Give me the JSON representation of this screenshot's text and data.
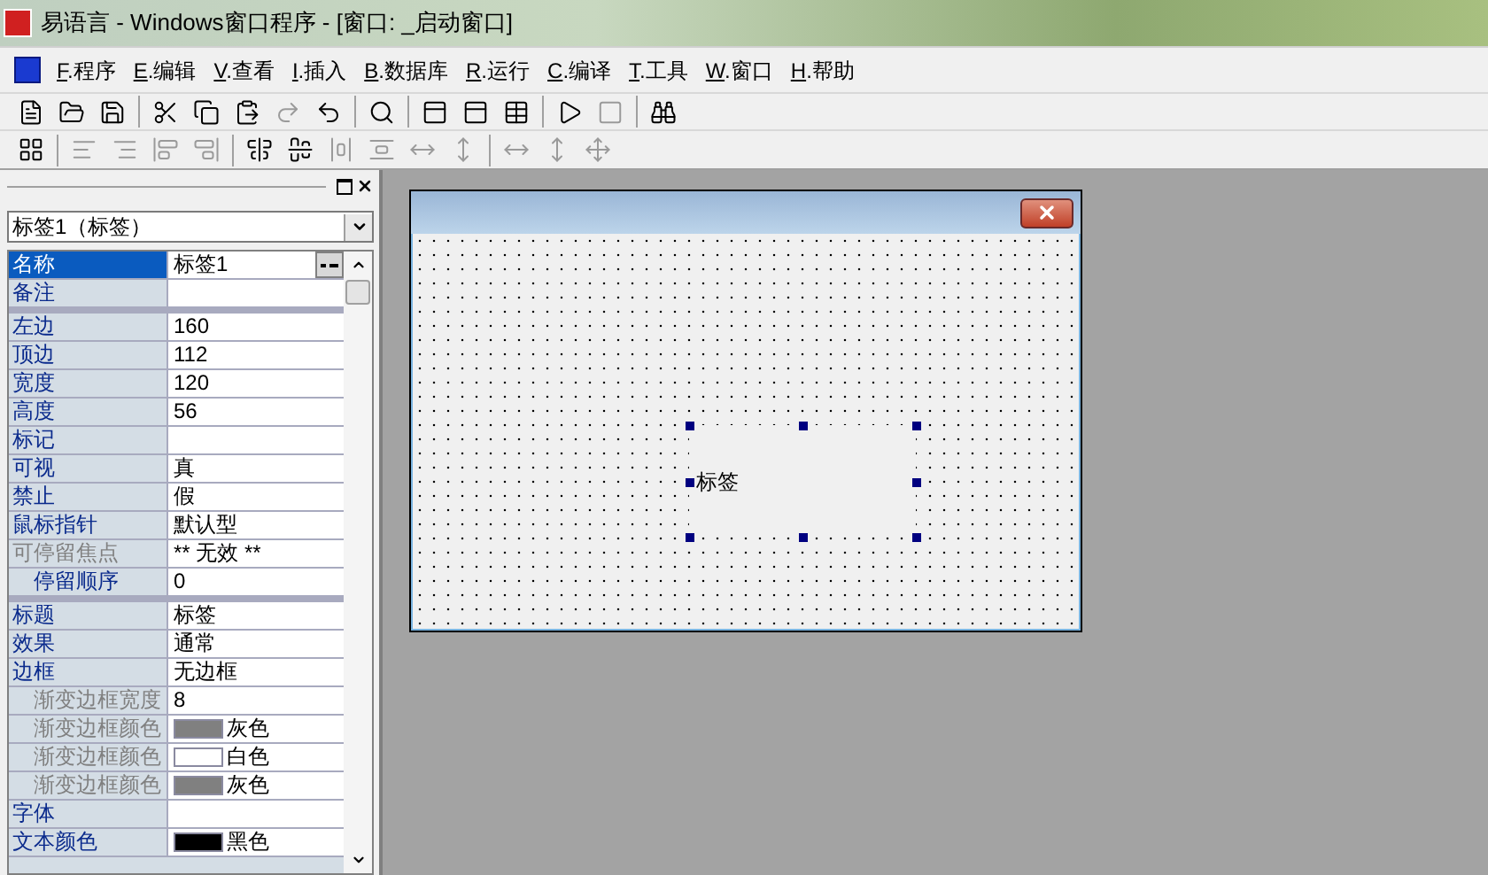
{
  "window": {
    "title": "易语言 - Windows窗口程序 - [窗口: _启动窗口]"
  },
  "menu": [
    {
      "label": "F.程序"
    },
    {
      "label": "E.编辑"
    },
    {
      "label": "V.查看"
    },
    {
      "label": "I.插入"
    },
    {
      "label": "B.数据库"
    },
    {
      "label": "R.运行"
    },
    {
      "label": "C.编译"
    },
    {
      "label": "T.工具"
    },
    {
      "label": "W.窗口"
    },
    {
      "label": "H.帮助"
    }
  ],
  "properties": {
    "object": "标签1（标签）",
    "groups": [
      {
        "rows": [
          {
            "name": "名称",
            "value": "标签1",
            "selected": true,
            "disabled": false,
            "editor": true
          },
          {
            "name": "备注",
            "value": "",
            "selected": false,
            "disabled": false
          }
        ]
      },
      {
        "rows": [
          {
            "name": "左边",
            "value": "160",
            "selected": false,
            "disabled": false
          },
          {
            "name": "顶边",
            "value": "112",
            "selected": false,
            "disabled": false
          },
          {
            "name": "宽度",
            "value": "120",
            "selected": false,
            "disabled": false
          },
          {
            "name": "高度",
            "value": "56",
            "selected": false,
            "disabled": false
          },
          {
            "name": "标记",
            "value": "",
            "selected": false,
            "disabled": false
          },
          {
            "name": "可视",
            "value": "真",
            "selected": false,
            "disabled": false
          },
          {
            "name": "禁止",
            "value": "假",
            "selected": false,
            "disabled": false
          },
          {
            "name": "鼠标指针",
            "value": "默认型",
            "selected": false,
            "disabled": false
          },
          {
            "name": "可停留焦点",
            "value": "** 无效 **",
            "selected": false,
            "disabled": true,
            "children": [
              {
                "name": "停留顺序",
                "value": "0",
                "selected": false,
                "disabled": false
              }
            ]
          }
        ]
      },
      {
        "rows": [
          {
            "name": "标题",
            "value": "标签",
            "selected": false,
            "disabled": false
          },
          {
            "name": "效果",
            "value": "通常",
            "selected": false,
            "disabled": false
          },
          {
            "name": "边框",
            "value": "无边框",
            "selected": false,
            "disabled": false,
            "children": [
              {
                "name": "渐变边框宽度",
                "value": "8",
                "selected": false,
                "disabled": true
              },
              {
                "name": "渐变边框颜色",
                "value": "灰色",
                "selected": false,
                "disabled": true,
                "color": "#808080"
              },
              {
                "name": "渐变边框颜色",
                "value": "白色",
                "selected": false,
                "disabled": true,
                "color": "#ffffff"
              },
              {
                "name": "渐变边框颜色",
                "value": "灰色",
                "selected": false,
                "disabled": true,
                "color": "#808080"
              }
            ]
          },
          {
            "name": "字体",
            "value": "",
            "selected": false,
            "disabled": false
          },
          {
            "name": "文本颜色",
            "value": "黑色",
            "selected": false,
            "disabled": false,
            "color": "#000000"
          }
        ]
      }
    ]
  },
  "designer": {
    "label": {
      "text": "标签",
      "selected": true
    }
  }
}
